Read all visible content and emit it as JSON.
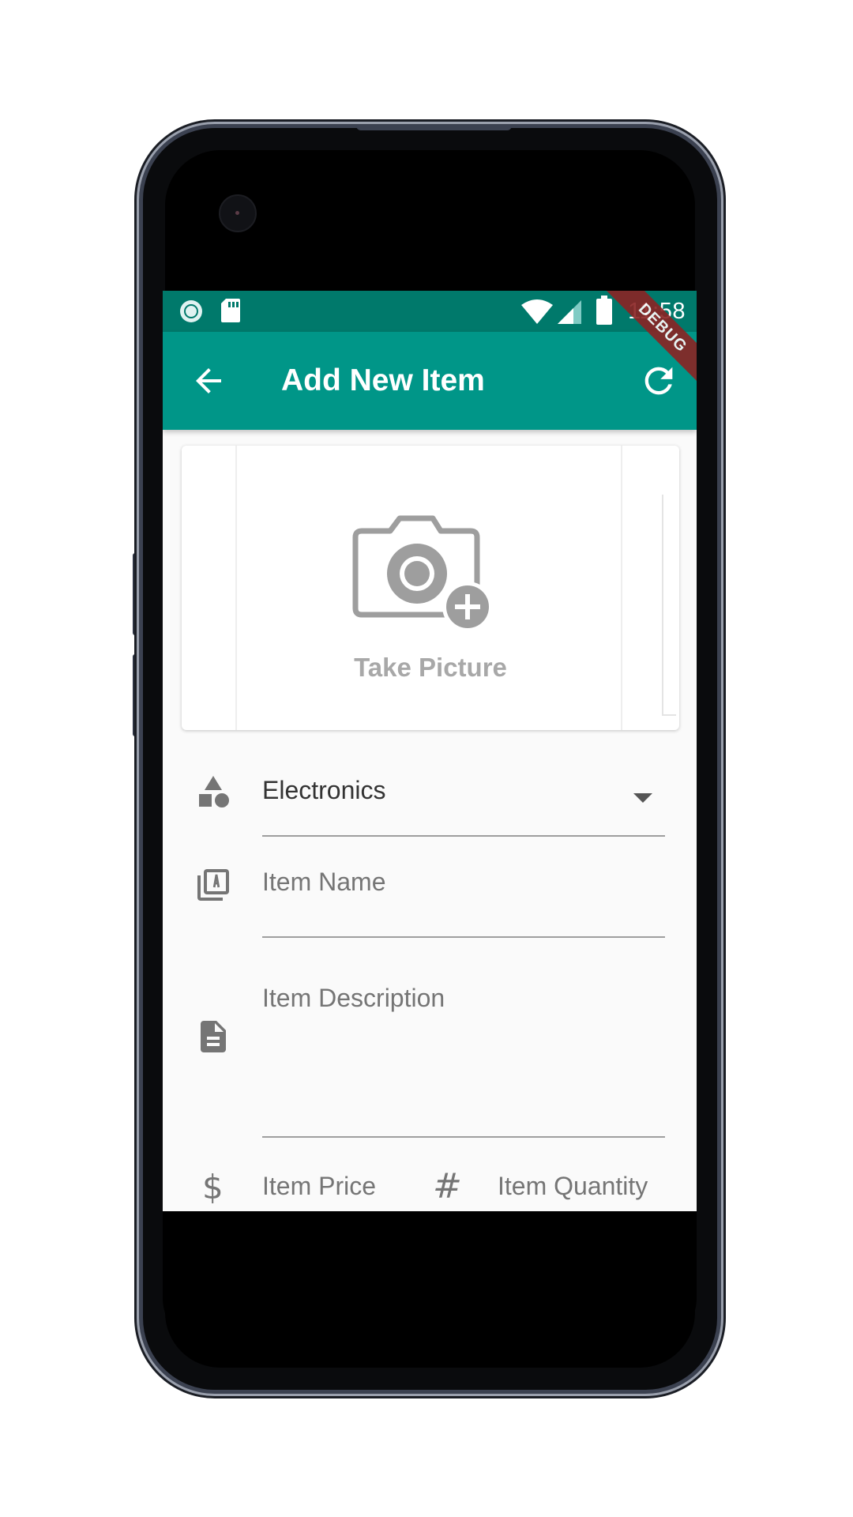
{
  "status_bar": {
    "time": "11:58",
    "icons": [
      "record-icon",
      "sd-card-icon",
      "wifi-icon",
      "signal-icon",
      "battery-icon"
    ]
  },
  "app_bar": {
    "title": "Add New Item",
    "back_icon": "arrow-back-icon",
    "refresh_icon": "refresh-icon",
    "debug_label": "DEBUG",
    "color": "#009688",
    "status_color": "#00796b"
  },
  "picture": {
    "label": "Take Picture",
    "icon": "add-a-photo-icon"
  },
  "form": {
    "category": {
      "icon": "category-icon",
      "value": "Electronics"
    },
    "name": {
      "icon": "library-books-icon",
      "placeholder": "Item Name"
    },
    "description": {
      "icon": "description-icon",
      "placeholder": "Item Description"
    },
    "price": {
      "icon": "dollar-icon",
      "placeholder": "Item Price"
    },
    "quantity": {
      "icon": "hash-icon",
      "placeholder": "Item Quantity"
    }
  }
}
